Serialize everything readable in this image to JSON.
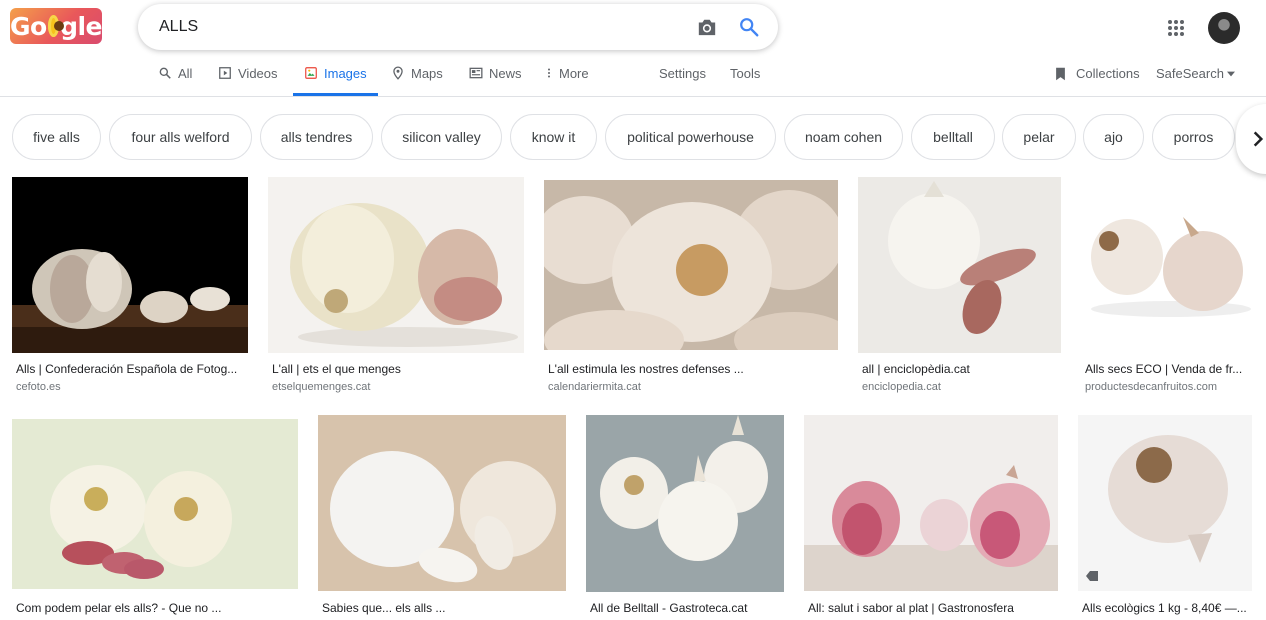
{
  "logo": {
    "left": "Go",
    "right": "gle"
  },
  "search": {
    "query": "ALLS"
  },
  "tabs": [
    {
      "label": "All",
      "icon": "search-icon"
    },
    {
      "label": "Videos",
      "icon": "play-icon"
    },
    {
      "label": "Images",
      "icon": "image-icon"
    },
    {
      "label": "Maps",
      "icon": "map-pin-icon"
    },
    {
      "label": "News",
      "icon": "newspaper-icon"
    },
    {
      "label": "More",
      "icon": "more-vert-icon"
    },
    {
      "label": "Settings"
    },
    {
      "label": "Tools"
    }
  ],
  "right_tools": {
    "collections": "Collections",
    "safesearch": "SafeSearch"
  },
  "chips": [
    "five alls",
    "four alls welford",
    "alls tendres",
    "silicon valley",
    "know it",
    "political powerhouse",
    "noam cohen",
    "belltall",
    "pelar",
    "ajo",
    "porros"
  ],
  "results_row1": [
    {
      "caption": "Alls | Confederación Española de Fotog...",
      "source": "cefoto.es"
    },
    {
      "caption": "L'all | ets el que menges",
      "source": "etselquemenges.cat"
    },
    {
      "caption": "L'all estimula les nostres defenses ...",
      "source": "calendariermita.cat"
    },
    {
      "caption": "all | enciclopèdia.cat",
      "source": "enciclopedia.cat"
    },
    {
      "caption": "Alls secs ECO | Venda de fr...",
      "source": "productesdecanfruitos.com"
    }
  ],
  "results_row2": [
    {
      "caption": "Com podem pelar els alls? - Que no ..."
    },
    {
      "caption": "Sabies que... els alls ..."
    },
    {
      "caption": "All de Belltall - Gastroteca.cat"
    },
    {
      "caption": "All: salut i sabor al plat | Gastronosfera"
    },
    {
      "caption": "Alls ecològics 1 kg - 8,40€ —..."
    }
  ],
  "colors": {
    "accent": "#1a73e8",
    "border": "#dfe1e5",
    "muted": "#5f6368"
  }
}
